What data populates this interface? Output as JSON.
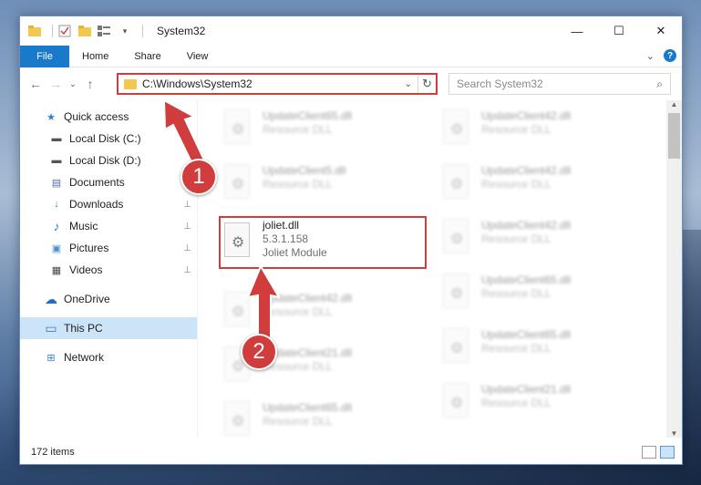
{
  "window": {
    "title": "System32",
    "controls": {
      "minimize": "—",
      "maximize": "☐",
      "close": "✕"
    }
  },
  "ribbon": {
    "tabs": [
      "File",
      "Home",
      "Share",
      "View"
    ],
    "expand_glyph": "⌄",
    "help_glyph": "?"
  },
  "nav": {
    "back": "←",
    "forward": "→",
    "recent": "⌄",
    "up": "↑",
    "address": "C:\\Windows\\System32",
    "address_dropdown": "⌄",
    "refresh": "↻",
    "search_placeholder": "Search System32",
    "search_glyph": "⌕"
  },
  "sidebar": {
    "items": [
      {
        "label": "Quick access",
        "icon": "star-icon",
        "glyph": "★",
        "color": "#2f80d1"
      },
      {
        "label": "Local Disk (C:)",
        "icon": "drive-icon",
        "glyph": "▬",
        "color": "#555555"
      },
      {
        "label": "Local Disk (D:)",
        "icon": "drive-icon",
        "glyph": "▬",
        "color": "#555555"
      },
      {
        "label": "Documents",
        "icon": "documents-icon",
        "glyph": "▤",
        "color": "#4a6fa5"
      },
      {
        "label": "Downloads",
        "icon": "downloads-icon",
        "glyph": "↓",
        "color": "#2f80d1"
      },
      {
        "label": "Music",
        "icon": "music-icon",
        "glyph": "♪",
        "color": "#2f80d1"
      },
      {
        "label": "Pictures",
        "icon": "pictures-icon",
        "glyph": "▣",
        "color": "#4a8fd1"
      },
      {
        "label": "Videos",
        "icon": "videos-icon",
        "glyph": "▦",
        "color": "#444444"
      },
      {
        "label": "OneDrive",
        "icon": "onedrive-icon",
        "glyph": "☁",
        "color": "#1e6fc4"
      },
      {
        "label": "This PC",
        "icon": "pc-icon",
        "glyph": "▭",
        "color": "#3a7cc4"
      },
      {
        "label": "Network",
        "icon": "network-icon",
        "glyph": "⊞",
        "color": "#3a7cc4"
      }
    ],
    "pin_glyph": "📌"
  },
  "files": {
    "left": [
      {
        "name": "UpdateClient65.dll",
        "type": "Resource DLL"
      },
      {
        "name": "UpdateClient5.dll",
        "type": "Resource DLL"
      },
      {
        "name": "joliet.dll",
        "version": "5.3.1.158",
        "type": "Joliet Module"
      },
      {
        "name": "UpdateClient42.dll",
        "type": "Resource DLL"
      },
      {
        "name": "UpdateClient21.dll",
        "type": "Resource DLL"
      },
      {
        "name": "UpdateClient65.dll",
        "type": "Resource DLL"
      }
    ],
    "right": [
      {
        "name": "UpdateClient42.dll",
        "type": "Resource DLL"
      },
      {
        "name": "UpdateClient42.dll",
        "type": "Resource DLL"
      },
      {
        "name": "UpdateClient42.dll",
        "type": "Resource DLL"
      },
      {
        "name": "UpdateClient65.dll",
        "type": "Resource DLL"
      },
      {
        "name": "UpdateClient65.dll",
        "type": "Resource DLL"
      },
      {
        "name": "UpdateClient21.dll",
        "type": "Resource DLL"
      }
    ]
  },
  "status": {
    "item_count": "172 items"
  },
  "annotations": {
    "step1": "1",
    "step2": "2",
    "color": "#d13c3c"
  }
}
